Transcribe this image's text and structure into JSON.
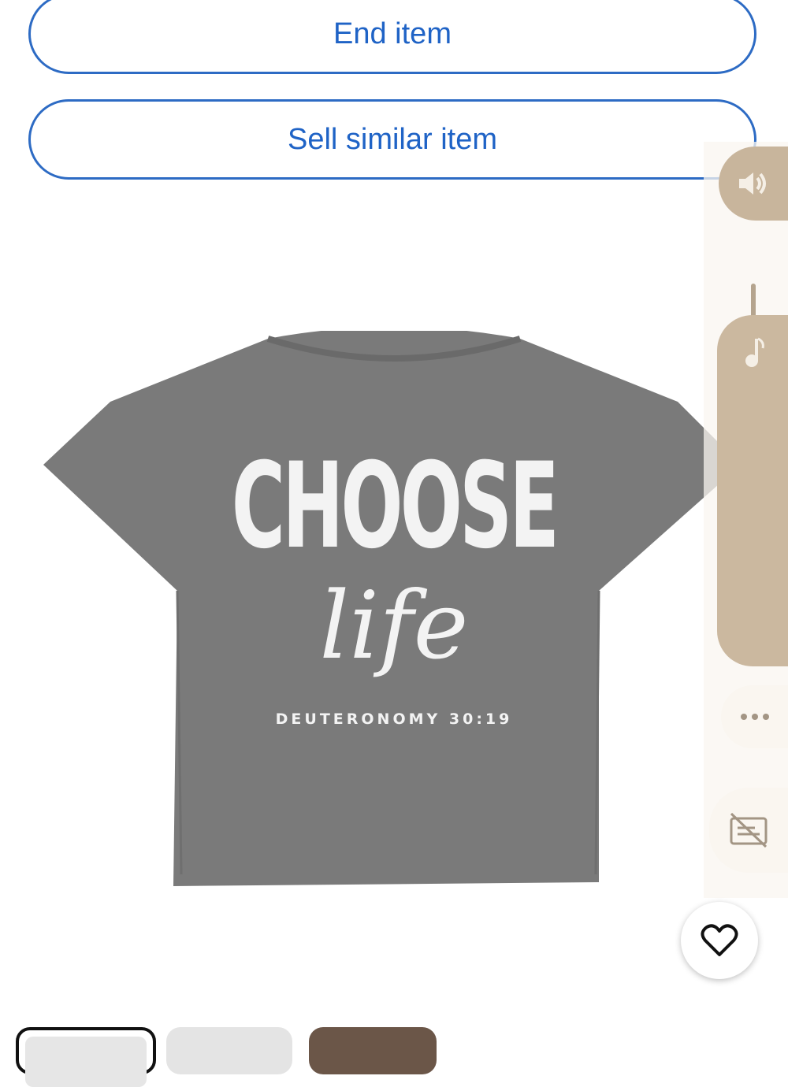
{
  "actions": {
    "end_item": "End item",
    "sell_similar": "Sell similar item"
  },
  "product_image": {
    "shirt_color": "#7a7a7a",
    "print_line1": "CHOOSE",
    "print_line2": "life",
    "print_line3": "DEUTERONOMY 30:19"
  },
  "side_panel": {
    "icons": [
      "speaker-icon",
      "music-note-icon",
      "more-dots-icon",
      "captions-off-icon"
    ],
    "accent": "#c8b59c"
  },
  "favorite": {
    "icon": "heart-icon"
  },
  "thumbnails": [
    "thumb-1",
    "thumb-2",
    "thumb-3"
  ],
  "colors": {
    "button_text": "#1f63c6",
    "button_border": "#2d6bc4"
  }
}
